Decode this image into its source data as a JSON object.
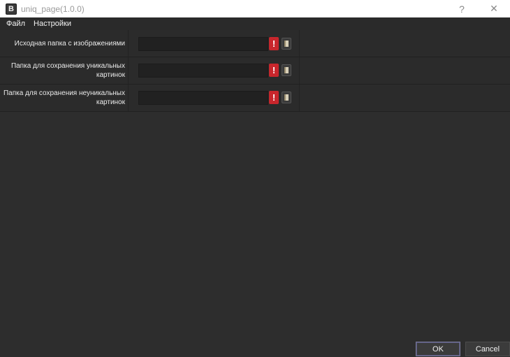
{
  "window": {
    "title": "uniq_page(1.0.0)",
    "icon_letter": "B",
    "help_glyph": "?",
    "close_glyph": "✕"
  },
  "menu": {
    "items": [
      {
        "label": "Файл"
      },
      {
        "label": "Настройки"
      }
    ]
  },
  "rows": [
    {
      "label": "Исходная папка с изображениями",
      "value": "",
      "warning": "!"
    },
    {
      "label": "Папка для сохранения уникальных картинок",
      "value": "",
      "warning": "!"
    },
    {
      "label": "Папка для сохранения неуникальных картинок",
      "value": "",
      "warning": "!"
    }
  ],
  "buttons": {
    "ok_label": "OK",
    "cancel_label": "Cancel"
  },
  "colors": {
    "background": "#2d2d2d",
    "warning": "#c8262c",
    "titlebar": "#ffffff"
  }
}
